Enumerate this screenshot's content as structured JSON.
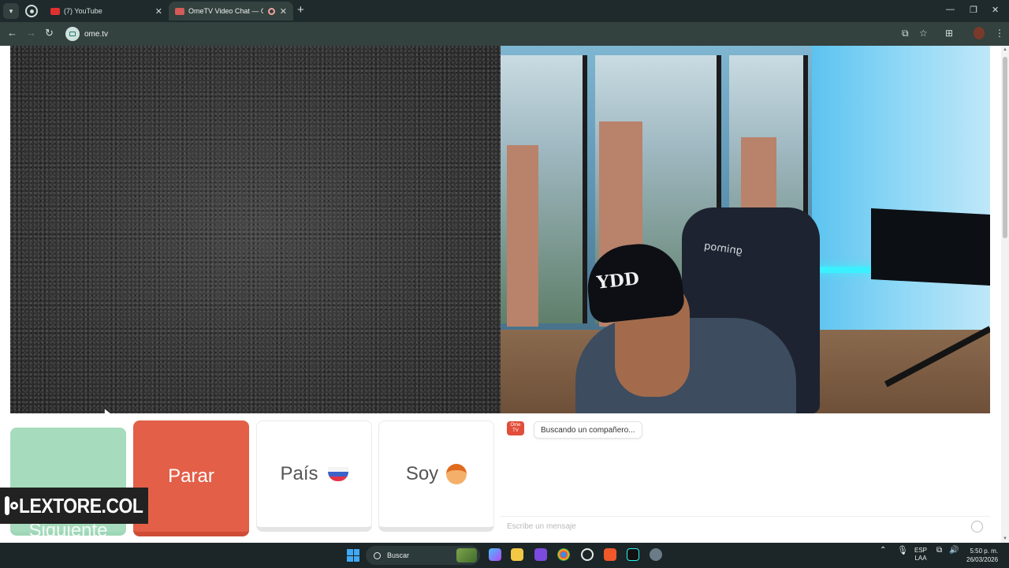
{
  "tabs": [
    {
      "title": "(7) YouTube",
      "favicon": "youtube-icon"
    },
    {
      "title": "OmeTV Video Chat — Ome",
      "favicon": "ometv-icon",
      "active": true
    }
  ],
  "toolbar": {
    "url": "ome.tv"
  },
  "controls": {
    "next_label": "Siguiente",
    "stop_label": "Parar",
    "country_label": "País",
    "gender_label": "Soy"
  },
  "watermark": {
    "text": "LEXTORE.COL"
  },
  "chat": {
    "logo_text": "Ome TV",
    "status_message": "Buscando un compañero...",
    "input_placeholder": "Escribe un mensaje"
  },
  "remote_video": {
    "chair_brand": "gnimoq"
  },
  "taskbar": {
    "search_label": "Buscar",
    "lang_top": "ESP",
    "lang_bottom": "LAA",
    "time": "5:50 p. m.",
    "date": "26/03/2026"
  },
  "colors": {
    "stop_button": "#e35f48",
    "next_button": "#a6dcbd",
    "browser_frame": "#33413f"
  }
}
